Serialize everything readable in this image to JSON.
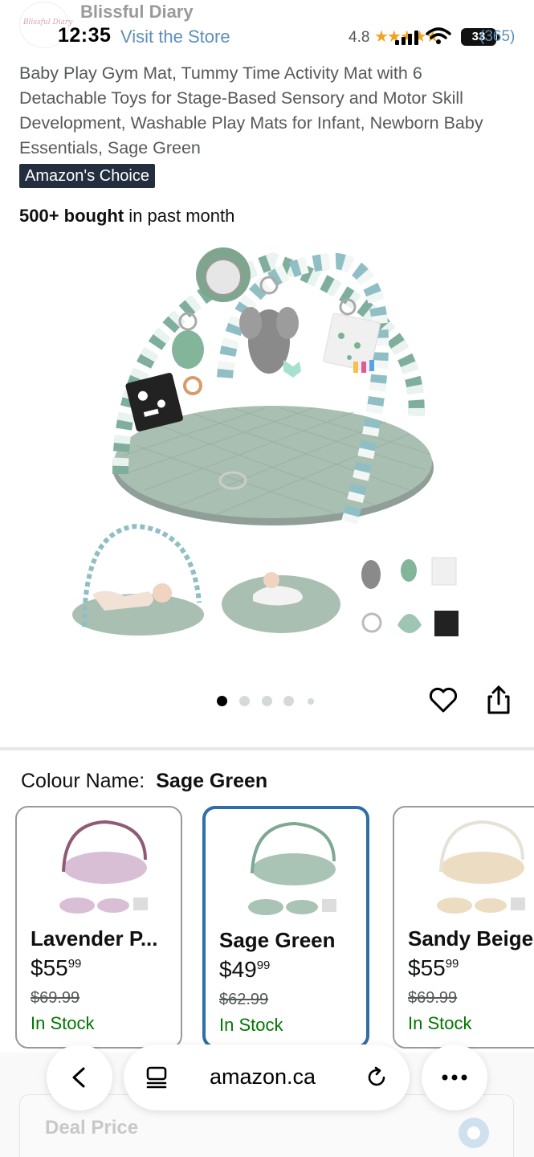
{
  "status_bar": {
    "time": "12:35",
    "battery": "33"
  },
  "store": {
    "logo_text": "Blissful Diary",
    "name": "Blissful Diary",
    "visit_link": "Visit the Store"
  },
  "rating": {
    "value": "4.8",
    "stars": "★★★★★",
    "count": "(365)",
    "star_color": "#f0a31f"
  },
  "product": {
    "title": "Baby Play Gym Mat, Tummy Time Activity Mat with 6 Detachable Toys for Stage-Based Sensory and Motor Skill Development, Washable Play Mats for Infant, Newborn Baby Essentials, Sage Green",
    "badge": "Amazon's Choice",
    "bought_bold": "500+ bought",
    "bought_rest": " in past month"
  },
  "carousel": {
    "total_dots": 5,
    "active_dot": 1
  },
  "colour": {
    "label": "Colour Name:",
    "selected": "Sage Green",
    "options": [
      {
        "name": "Lavender P...",
        "price_dollars": "$55",
        "price_cents": "99",
        "old_price": "$69.99",
        "stock": "In Stock",
        "mat_color": "#d9bfd6",
        "arch_color": "#8e5a75"
      },
      {
        "name": "Sage Green",
        "price_dollars": "$49",
        "price_cents": "99",
        "old_price": "$62.99",
        "stock": "In Stock",
        "mat_color": "#a9c4b4",
        "arch_color": "#7fa894"
      },
      {
        "name": "Sandy Beige",
        "price_dollars": "$55",
        "price_cents": "99",
        "old_price": "$69.99",
        "stock": "In Stock",
        "mat_color": "#ecdcc2",
        "arch_color": "#e7e2d8"
      }
    ]
  },
  "deal": {
    "label": "Deal Price"
  },
  "browser": {
    "url": "amazon.ca"
  },
  "colors": {
    "link": "#5d8fb8",
    "in_stock": "#007600",
    "selected_border": "#2f6ea6",
    "badge_bg": "#232f3e"
  }
}
